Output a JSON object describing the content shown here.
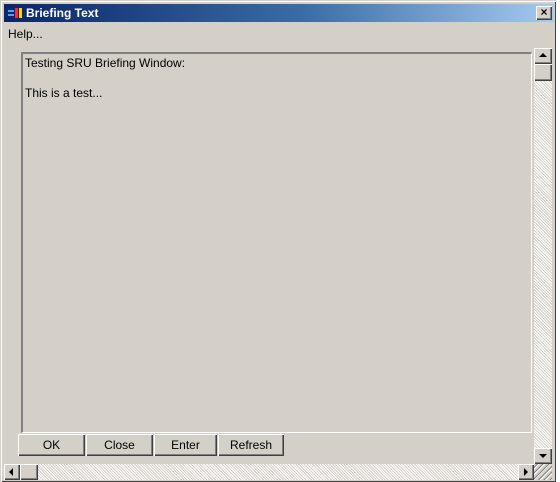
{
  "window": {
    "title": "Briefing Text",
    "close_label": "×"
  },
  "menu": {
    "help_label": "Help..."
  },
  "briefing": {
    "line1": "Testing SRU Briefing Window:",
    "line2": "This is a test..."
  },
  "buttons": {
    "ok": "OK",
    "close": "Close",
    "enter": "Enter",
    "refresh": "Refresh"
  },
  "colors": {
    "titlebar_start": "#0a246a",
    "titlebar_end": "#a6caf0",
    "face": "#d4d0c8"
  },
  "icons": {
    "app": "application-icon",
    "close": "close-icon",
    "scroll_up": "arrow-up-icon",
    "scroll_down": "arrow-down-icon",
    "scroll_left": "arrow-left-icon",
    "scroll_right": "arrow-right-icon"
  }
}
